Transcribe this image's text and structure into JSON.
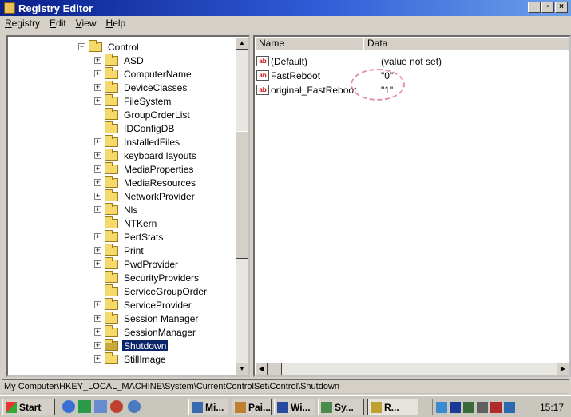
{
  "window": {
    "title": "Registry Editor"
  },
  "menu": [
    "Registry",
    "Edit",
    "View",
    "Help"
  ],
  "tree": [
    {
      "label": "Control",
      "expander": "minus",
      "level": 0
    },
    {
      "label": "ASD",
      "expander": "plus",
      "level": 1
    },
    {
      "label": "ComputerName",
      "expander": "plus",
      "level": 1
    },
    {
      "label": "DeviceClasses",
      "expander": "plus",
      "level": 1
    },
    {
      "label": "FileSystem",
      "expander": "plus",
      "level": 1
    },
    {
      "label": "GroupOrderList",
      "expander": "none",
      "level": 1
    },
    {
      "label": "IDConfigDB",
      "expander": "none",
      "level": 1
    },
    {
      "label": "InstalledFiles",
      "expander": "plus",
      "level": 1
    },
    {
      "label": "keyboard layouts",
      "expander": "plus",
      "level": 1
    },
    {
      "label": "MediaProperties",
      "expander": "plus",
      "level": 1
    },
    {
      "label": "MediaResources",
      "expander": "plus",
      "level": 1
    },
    {
      "label": "NetworkProvider",
      "expander": "plus",
      "level": 1
    },
    {
      "label": "Nls",
      "expander": "plus",
      "level": 1
    },
    {
      "label": "NTKern",
      "expander": "none",
      "level": 1
    },
    {
      "label": "PerfStats",
      "expander": "plus",
      "level": 1
    },
    {
      "label": "Print",
      "expander": "plus",
      "level": 1
    },
    {
      "label": "PwdProvider",
      "expander": "plus",
      "level": 1
    },
    {
      "label": "SecurityProviders",
      "expander": "none",
      "level": 1
    },
    {
      "label": "ServiceGroupOrder",
      "expander": "none",
      "level": 1
    },
    {
      "label": "ServiceProvider",
      "expander": "plus",
      "level": 1
    },
    {
      "label": "Session Manager",
      "expander": "plus",
      "level": 1
    },
    {
      "label": "SessionManager",
      "expander": "plus",
      "level": 1
    },
    {
      "label": "Shutdown",
      "expander": "plus",
      "level": 1,
      "selected": true
    },
    {
      "label": "StillImage",
      "expander": "plus",
      "level": 1
    }
  ],
  "list": {
    "columns": [
      "Name",
      "Data"
    ],
    "rows": [
      {
        "name": "(Default)",
        "data": "(value not set)"
      },
      {
        "name": "FastReboot",
        "data": "\"0\""
      },
      {
        "name": "original_FastReboot",
        "data": "\"1\""
      }
    ]
  },
  "status": "My Computer\\HKEY_LOCAL_MACHINE\\System\\CurrentControlSet\\Control\\Shutdown",
  "taskbar": {
    "start": "Start",
    "tasks": [
      {
        "label": "Mi...",
        "active": false
      },
      {
        "label": "Pai...",
        "active": false
      },
      {
        "label": "Wi...",
        "active": false
      },
      {
        "label": "Sy...",
        "active": false
      },
      {
        "label": "R...",
        "active": true
      }
    ],
    "clock": "15:17"
  },
  "colors": {
    "titlebar": "#0a246a",
    "selection": "#0a246a",
    "folder": "#f6d96b"
  }
}
